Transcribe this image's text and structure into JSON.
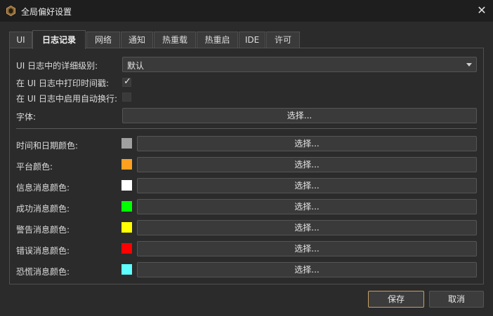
{
  "window": {
    "title": "全局偏好设置",
    "close_glyph": "✕"
  },
  "tabs": [
    {
      "label": "UI"
    },
    {
      "label": "日志记录",
      "active": true
    },
    {
      "label": "网络"
    },
    {
      "label": "通知"
    },
    {
      "label": "热重载"
    },
    {
      "label": "热重启"
    },
    {
      "label": "IDE"
    },
    {
      "label": "许可"
    }
  ],
  "logging": {
    "verbosity_label": "UI 日志中的详细级别:",
    "verbosity_value": "默认",
    "timestamp_label": "在 UI 日志中打印时间戳:",
    "timestamp_checked": true,
    "wrap_label": "在 UI 日志中启用自动换行:",
    "wrap_checked": false,
    "font_label": "字体:",
    "font_button": "选择..."
  },
  "colors": [
    {
      "label": "时间和日期颜色:",
      "color": "#a0a0a0",
      "button": "选择..."
    },
    {
      "label": "平台颜色:",
      "color": "#ffa020",
      "button": "选择..."
    },
    {
      "label": "信息消息颜色:",
      "color": "#ffffff",
      "button": "选择..."
    },
    {
      "label": "成功消息颜色:",
      "color": "#00ff00",
      "button": "选择..."
    },
    {
      "label": "警告消息颜色:",
      "color": "#ffff00",
      "button": "选择..."
    },
    {
      "label": "错误消息颜色:",
      "color": "#ff0000",
      "button": "选择..."
    },
    {
      "label": "恐慌消息颜色:",
      "color": "#5fffff",
      "button": "选择..."
    }
  ],
  "footer": {
    "save": "保存",
    "cancel": "取消"
  },
  "icons": {
    "app": "unreal-gear-icon",
    "close": "close-icon",
    "dropdown": "chevron-down-icon",
    "check": "checkmark-icon"
  }
}
